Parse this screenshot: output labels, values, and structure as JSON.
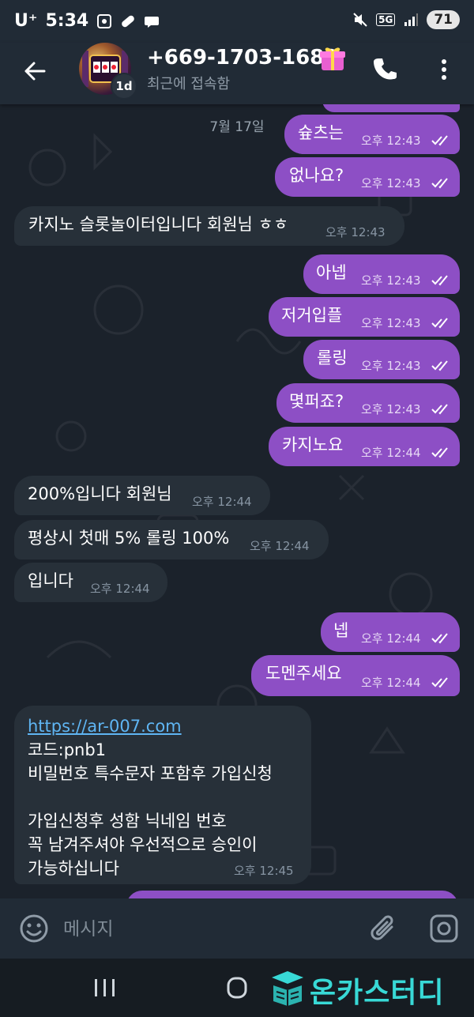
{
  "status_bar": {
    "carrier": "U⁺",
    "time": "5:34",
    "network": "5G",
    "battery": "71"
  },
  "header": {
    "contact_name": "+669-1703-1689",
    "contact_status": "최근에 접속함",
    "avatar_badge": "1d"
  },
  "date_label": "7월 17일",
  "messages": [
    {
      "dir": "out",
      "text": "슢츠는",
      "time": "오후 12:43"
    },
    {
      "dir": "out",
      "text": "없나요?",
      "time": "오후 12:43"
    },
    {
      "dir": "in",
      "text": "카지노 슬롯놀이터입니다 회원님 ㅎㅎ",
      "time": "오후 12:43"
    },
    {
      "dir": "out",
      "text": "아넵",
      "time": "오후 12:43"
    },
    {
      "dir": "out",
      "text": "저거입플",
      "time": "오후 12:43"
    },
    {
      "dir": "out",
      "text": "롤링",
      "time": "오후 12:43"
    },
    {
      "dir": "out",
      "text": "몇퍼죠?",
      "time": "오후 12:43"
    },
    {
      "dir": "out",
      "text": "카지노요",
      "time": "오후 12:44"
    },
    {
      "dir": "in",
      "text": "200%입니다 회원님",
      "time": "오후 12:44"
    },
    {
      "dir": "in",
      "text": "평상시 첫매 5% 롤링 100%",
      "time": "오후 12:44"
    },
    {
      "dir": "in",
      "text": "입니다",
      "time": "오후 12:44"
    },
    {
      "dir": "out",
      "text": "넵",
      "time": "오후 12:44"
    },
    {
      "dir": "out",
      "text": "도멘주세요",
      "time": "오후 12:44"
    },
    {
      "dir": "in",
      "link": "https://ar-007.com",
      "lines": [
        "코드:pnb1",
        "비밀번호 특수문자 포함후 가입신청",
        "",
        "가입신청후  성함 닉네임 번호",
        "꼭 남겨주셔야 우선적으로 승인이",
        "가능하십니다"
      ],
      "time": "오후 12:45"
    }
  ],
  "input": {
    "placeholder": "메시지"
  },
  "watermark": {
    "text": "온카스터디"
  },
  "colors": {
    "outgoing_bubble": "#8d4fc5",
    "incoming_bubble": "#273039",
    "link": "#5fb5f3",
    "watermark": "#38d9d6"
  },
  "icons": [
    "back-arrow-icon",
    "gift-icon",
    "phone-icon",
    "more-vert-icon",
    "emoji-icon",
    "attach-icon",
    "camera-icon"
  ]
}
